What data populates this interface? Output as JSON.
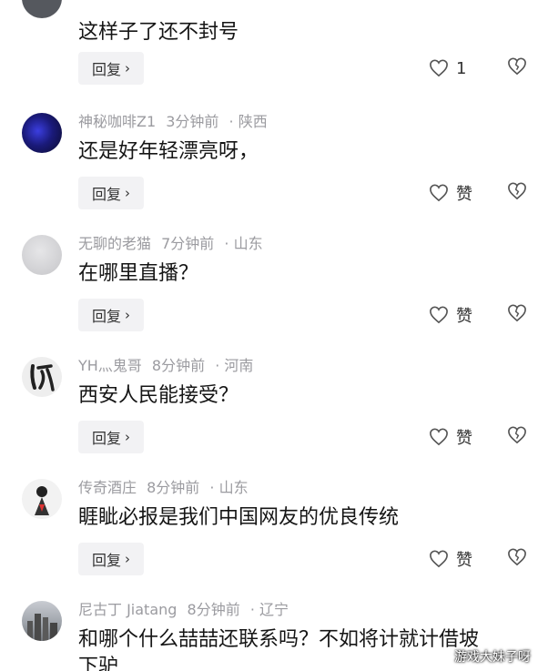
{
  "comments": [
    {
      "user": "",
      "time": "",
      "location": "",
      "text": "这样子了还不封号",
      "reply": "回复",
      "like": "1"
    },
    {
      "user": "神秘咖啡Z1",
      "time": "3分钟前",
      "location": "· 陕西",
      "text": "还是好年轻漂亮呀，",
      "reply": "回复",
      "like": "赞"
    },
    {
      "user": "无聊的老猫",
      "time": "7分钟前",
      "location": "· 山东",
      "text": "在哪里直播？",
      "reply": "回复",
      "like": "赞"
    },
    {
      "user": "YH灬鬼哥",
      "time": "8分钟前",
      "location": "· 河南",
      "text": "西安人民能接受？",
      "reply": "回复",
      "like": "赞"
    },
    {
      "user": "传奇酒庄",
      "time": "8分钟前",
      "location": "· 山东",
      "text": "睚眦必报是我们中国网友的优良传统",
      "reply": "回复",
      "like": "赞"
    },
    {
      "user": "尼古丁 Jiatang",
      "time": "8分钟前",
      "location": "· 辽宁",
      "text": "和哪个什么喆喆还联系吗？不如将计就计借坡",
      "text2": "下驴",
      "reply": "",
      "like": ""
    }
  ],
  "watermark": "游戏大妹子呀"
}
